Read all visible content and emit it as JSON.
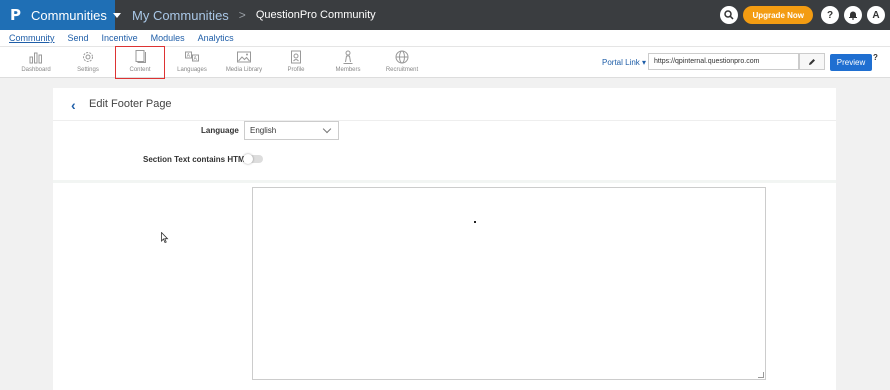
{
  "topbar": {
    "logo": "P",
    "app_name": "Communities",
    "breadcrumb_1": "My Communities",
    "breadcrumb_sep": ">",
    "breadcrumb_2": "QuestionPro Community",
    "upgrade_label": "Upgrade Now",
    "help_glyph": "?",
    "user_initial": "A",
    "brand_color": "#1f6fb5",
    "accent_color": "#f39c12"
  },
  "mainnav": {
    "items": [
      "Community",
      "Send",
      "Incentive",
      "Modules",
      "Analytics"
    ],
    "active": "Community"
  },
  "toolbar": {
    "tools": [
      {
        "label": "Dashboard",
        "icon": "bar-chart-icon"
      },
      {
        "label": "Settings",
        "icon": "gear-icon"
      },
      {
        "label": "Content",
        "icon": "document-icon",
        "selected": true
      },
      {
        "label": "Languages",
        "icon": "translate-icon"
      },
      {
        "label": "Media Library",
        "icon": "image-icon"
      },
      {
        "label": "Profile",
        "icon": "profile-icon"
      },
      {
        "label": "Members",
        "icon": "members-icon"
      },
      {
        "label": "Recruitment",
        "icon": "globe-icon"
      }
    ],
    "portal_link_label": "Portal Link ▾",
    "portal_url": "https://qpinternal.questionpro.com",
    "preview_label": "Preview",
    "help_glyph": "?"
  },
  "page": {
    "title": "Edit Footer Page",
    "language_label": "Language",
    "language_value": "English",
    "html_label": "Section Text contains HTML",
    "html_toggle": false
  }
}
